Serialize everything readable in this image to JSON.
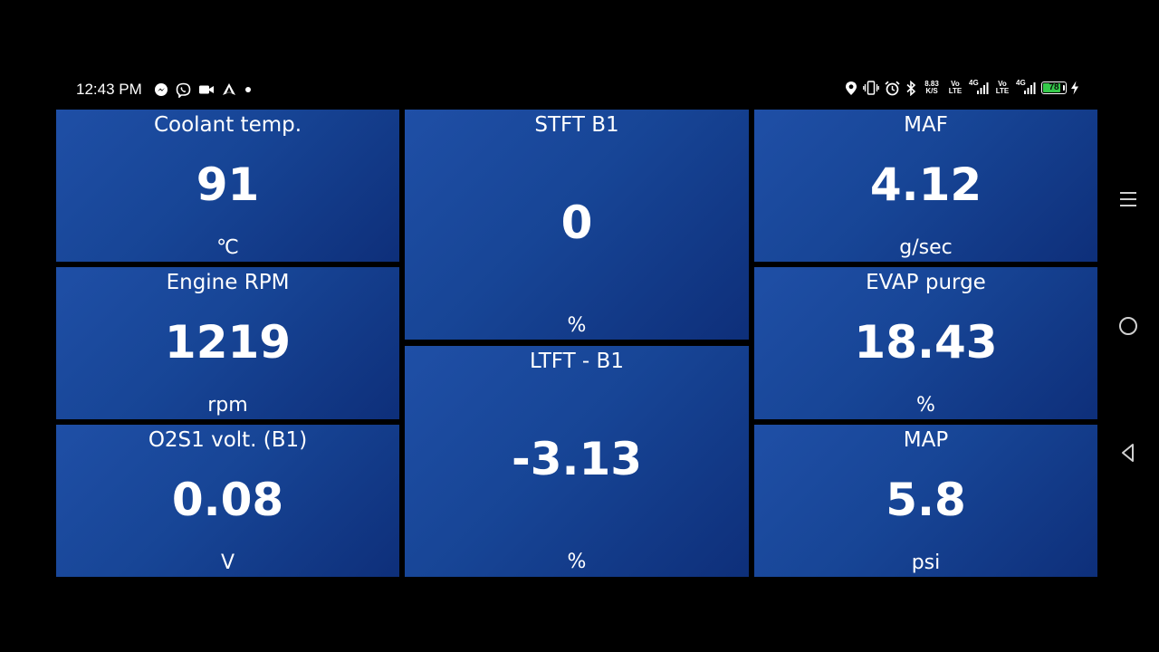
{
  "status_bar": {
    "time": "12:43 PM",
    "left_icons": [
      "messenger-icon",
      "viber-icon",
      "video-camera-icon",
      "navigation-icon",
      "dot-icon"
    ],
    "right_icons": [
      "location-icon",
      "vibrate-icon",
      "bluetooth-icon",
      "alarm-icon"
    ],
    "net_speed_value": "8.83",
    "net_speed_unit": "K/S",
    "volte1_top": "Vo",
    "volte1_bottom": "LTE",
    "net1": "4G",
    "volte2_top": "Vo",
    "volte2_bottom": "LTE",
    "net2": "4G",
    "battery_level": "78",
    "charging_icon": "lightning-icon"
  },
  "tiles": {
    "coolant": {
      "title": "Coolant temp.",
      "value": "91",
      "unit": "℃"
    },
    "rpm": {
      "title": "Engine RPM",
      "value": "1219",
      "unit": "rpm"
    },
    "o2s1": {
      "title": "O2S1 volt. (B1)",
      "value": "0.08",
      "unit": "V"
    },
    "stft": {
      "title": "STFT B1",
      "value": "0",
      "unit": "%"
    },
    "ltft": {
      "title": "LTFT - B1",
      "value": "-3.13",
      "unit": "%"
    },
    "maf": {
      "title": "MAF",
      "value": "4.12",
      "unit": "g/sec"
    },
    "evap": {
      "title": "EVAP purge",
      "value": "18.43",
      "unit": "%"
    },
    "map": {
      "title": "MAP",
      "value": "5.8",
      "unit": "psi"
    }
  },
  "nav": {
    "menu_icon": "menu-icon",
    "home_icon": "home-circle-icon",
    "back_icon": "back-triangle-icon"
  },
  "colors": {
    "tile_bg_start": "#1f4fa6",
    "tile_bg_end": "#0e2f7a",
    "battery_fill": "#35c94a"
  }
}
